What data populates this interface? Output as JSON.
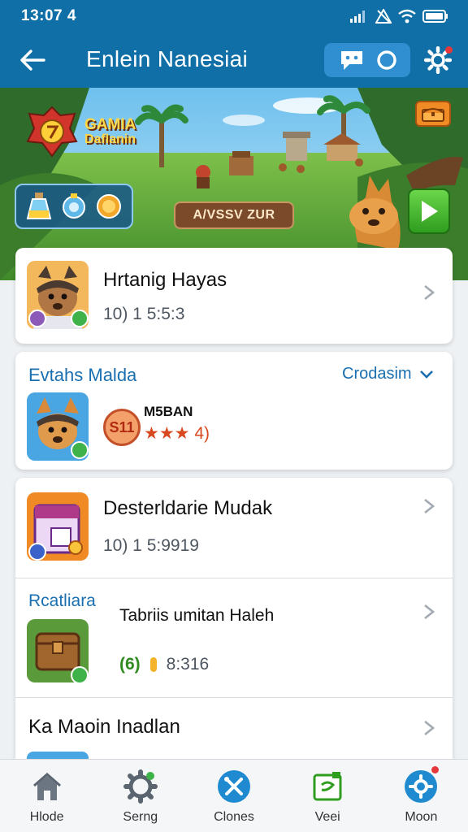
{
  "status_bar": {
    "time": "13:07 4"
  },
  "app_bar": {
    "title": "Enlein Nanesiai"
  },
  "banner": {
    "logo_line1": "GAMIA",
    "logo_line2": "Daflanin",
    "cta_label": "A/VSSV ZUR"
  },
  "rows": [
    {
      "title": "Hrtanig Hayas",
      "subtitle": "10) 1 5:5:3"
    },
    {
      "section": "Evtahs Malda",
      "section_link": "Crodasim",
      "sticker": "S11",
      "title": "M5BAN",
      "rating": "★★★ 4)"
    },
    {
      "title": "Desterldarie Mudak",
      "subtitle": "10) 1 5:9919"
    },
    {
      "section": "Rcatliara",
      "title": "Tabriis umitan Haleh",
      "subtitle_a": "(6)",
      "subtitle_b": "8:316"
    },
    {
      "title": "Ka Maoin Inadlan"
    }
  ],
  "nav": [
    {
      "label": "Hlode",
      "icon": "home-icon"
    },
    {
      "label": "Serng",
      "icon": "gear-icon"
    },
    {
      "label": "Clones",
      "icon": "tools-icon"
    },
    {
      "label": "Veei",
      "icon": "ticket-icon"
    },
    {
      "label": "Moon",
      "icon": "settings-icon"
    }
  ],
  "colors": {
    "primary": "#0f6fa6",
    "accent_green": "#2f9d1f",
    "link": "#1a6fb0",
    "badge_red": "#e5383b"
  }
}
